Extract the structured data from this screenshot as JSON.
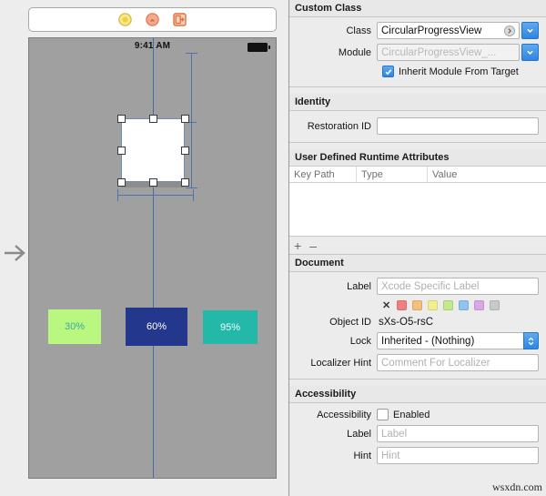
{
  "canvas": {
    "dock": {
      "items": [
        {
          "name": "view-controller-icon",
          "color": "#f0d23c"
        },
        {
          "name": "first-responder-icon",
          "color": "#f08060"
        },
        {
          "name": "exit-icon",
          "color": "#e8713d"
        }
      ]
    },
    "status_bar": {
      "time": "9:41 AM",
      "battery_icon": "battery-icon"
    },
    "selected_view": {
      "name": "circular-progress-view",
      "handles": 8
    },
    "progress_boxes": [
      {
        "label": "30%",
        "bg": "#b9f781",
        "fg": "#3aa99a"
      },
      {
        "label": "60%",
        "bg": "#23388c",
        "fg": "#ffffff"
      },
      {
        "label": "95%",
        "bg": "#24b8a8",
        "fg": "#eafffb"
      }
    ]
  },
  "inspector": {
    "custom_class": {
      "header": "Custom Class",
      "class_label": "Class",
      "class_value": "CircularProgressView",
      "module_label": "Module",
      "module_value": "CircularProgressView_...",
      "inherit_label": "Inherit Module From Target",
      "inherit_checked": true
    },
    "identity": {
      "header": "Identity",
      "restoration_label": "Restoration ID",
      "restoration_value": ""
    },
    "runtime": {
      "header": "User Defined Runtime Attributes",
      "columns": [
        "Key Path",
        "Type",
        "Value"
      ],
      "rows": [],
      "add_button": "+",
      "remove_button": "–"
    },
    "document": {
      "header": "Document",
      "label_label": "Label",
      "label_placeholder": "Xcode Specific Label",
      "label_value": "",
      "swatch_clear": "✕",
      "swatches": [
        "#f08080",
        "#f5c07a",
        "#f2ef8f",
        "#c4e88a",
        "#8fc4f0",
        "#d9a8e8",
        "#c9c9c9"
      ],
      "object_id_label": "Object ID",
      "object_id_value": "sXs-O5-rsC",
      "lock_label": "Lock",
      "lock_value": "Inherited - (Nothing)",
      "localizer_label": "Localizer Hint",
      "localizer_placeholder": "Comment For Localizer",
      "localizer_value": ""
    },
    "accessibility": {
      "header": "Accessibility",
      "accessibility_label": "Accessibility",
      "enabled_label": "Enabled",
      "enabled_checked": false,
      "label_label": "Label",
      "label_placeholder": "Label",
      "label_value": "",
      "hint_label": "Hint",
      "hint_placeholder": "Hint",
      "hint_value": ""
    }
  },
  "watermark": "wsxdn.com"
}
